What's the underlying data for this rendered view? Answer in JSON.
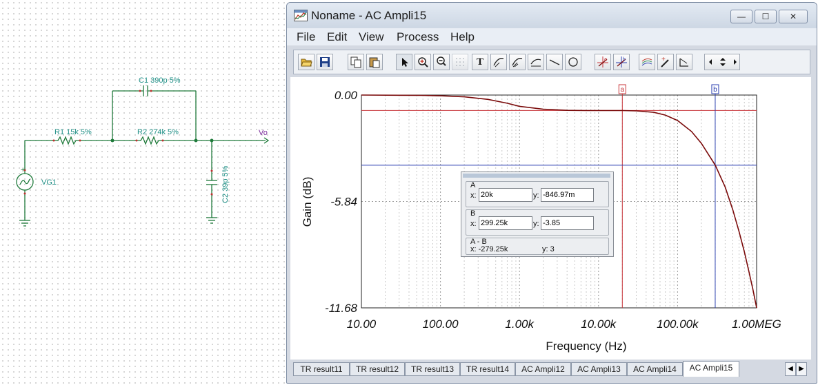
{
  "schematic": {
    "c1_label": "C1 390p 5%",
    "r1_label": "R1 15k 5%",
    "r2_label": "R2 274k 5%",
    "c2_label": "C2 39p 5%",
    "vg1_label": "VG1",
    "output_label": "Vo",
    "accent": "#1f8f86"
  },
  "window": {
    "title": "Noname - AC Ampli15",
    "minimize": "—",
    "maximize": "☐",
    "close": "✕"
  },
  "menu": [
    "File",
    "Edit",
    "View",
    "Process",
    "Help"
  ],
  "toolbar": {
    "icons": [
      "open-icon",
      "save-icon",
      "copy-icon",
      "paste-icon",
      "pointer-icon",
      "zoom-in-icon",
      "zoom-100-icon",
      "grid-icon",
      "text-icon",
      "curve-tool-icon",
      "curve-tool2-icon",
      "curve-tool3-icon",
      "line-icon",
      "circle-icon",
      "cursor-a-icon",
      "cursor-b-icon",
      "multi-curve-icon",
      "marker-icon",
      "angle-icon",
      "scroll-icon"
    ],
    "text_tool": "T",
    "cursor_a": "a",
    "cursor_b": "b"
  },
  "chart_data": {
    "type": "line",
    "title": "",
    "xlabel": "Frequency (Hz)",
    "ylabel": "Gain (dB)",
    "x_scale": "log",
    "xlim": [
      10,
      1000000
    ],
    "ylim": [
      -11.68,
      0
    ],
    "x_tick_labels": [
      "10.00",
      "100.00",
      "1.00k",
      "10.00k",
      "100.00k",
      "1.00MEG"
    ],
    "y_tick_labels": [
      "0.00",
      "-5.84",
      "-11.68"
    ],
    "grid": true,
    "series": [
      {
        "color": "#7a0a0a",
        "x": [
          10,
          30,
          60,
          100,
          200,
          400,
          700,
          1000,
          2000,
          4000,
          7000,
          10000,
          20000,
          30000,
          50000,
          70000,
          100000,
          150000,
          200000,
          300000,
          400000,
          500000,
          600000,
          700000,
          800000,
          900000,
          1000000
        ],
        "y": [
          0,
          -0.01,
          -0.02,
          -0.04,
          -0.1,
          -0.24,
          -0.45,
          -0.62,
          -0.78,
          -0.84,
          -0.85,
          -0.85,
          -0.85,
          -0.87,
          -0.95,
          -1.1,
          -1.4,
          -2.0,
          -2.65,
          -3.85,
          -5.05,
          -6.3,
          -7.5,
          -8.6,
          -9.7,
          -10.7,
          -11.68
        ]
      }
    ],
    "cursors": [
      {
        "label": "a",
        "x": 20000,
        "y": -0.84697,
        "color": "#c8353a"
      },
      {
        "label": "b",
        "x": 299250,
        "y": -3.85,
        "color": "#2b3fb0"
      }
    ]
  },
  "readout": {
    "a_label": "A",
    "a_x": "20k",
    "a_y": "-846.97m",
    "b_label": "B",
    "b_x": "299.25k",
    "b_y": "-3.85",
    "diff_label": "A - B",
    "diff_x": "x:  -279.25k",
    "diff_y": "y: 3",
    "x_prefix": "x:",
    "y_prefix": "y:"
  },
  "tabs": [
    "TR result11",
    "TR result12",
    "TR result13",
    "TR result14",
    "AC Ampli12",
    "AC Ampli13",
    "AC Ampli14",
    "AC Ampli15"
  ],
  "active_tab": "AC Ampli15"
}
